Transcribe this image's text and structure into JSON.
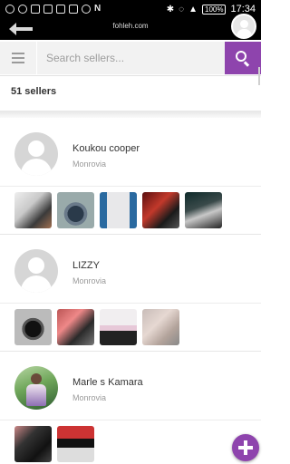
{
  "status_bar": {
    "battery": "100%",
    "time": "17:34",
    "left_icons": [
      "person-icon",
      "shield-icon",
      "download-icon",
      "email-icon",
      "image-icon",
      "download-icon",
      "clock-icon",
      "n-icon"
    ]
  },
  "header": {
    "site_title": "fohleh.com"
  },
  "search": {
    "placeholder": "Search sellers..."
  },
  "summary": {
    "count_text": "51 sellers"
  },
  "sellers": [
    {
      "name": "Koukou cooper",
      "location": "Monrovia",
      "avatar": "placeholder",
      "thumbnail_count": 5
    },
    {
      "name": "LIZZY",
      "location": "Monrovia",
      "avatar": "placeholder",
      "thumbnail_count": 4
    },
    {
      "name": "Marle s Kamara",
      "location": "Monrovia",
      "avatar": "photo",
      "thumbnail_count": 2
    }
  ],
  "colors": {
    "accent": "#8e44ad",
    "status_bar": "#000000",
    "text_primary": "#333333",
    "text_secondary": "#9a9a9a"
  }
}
